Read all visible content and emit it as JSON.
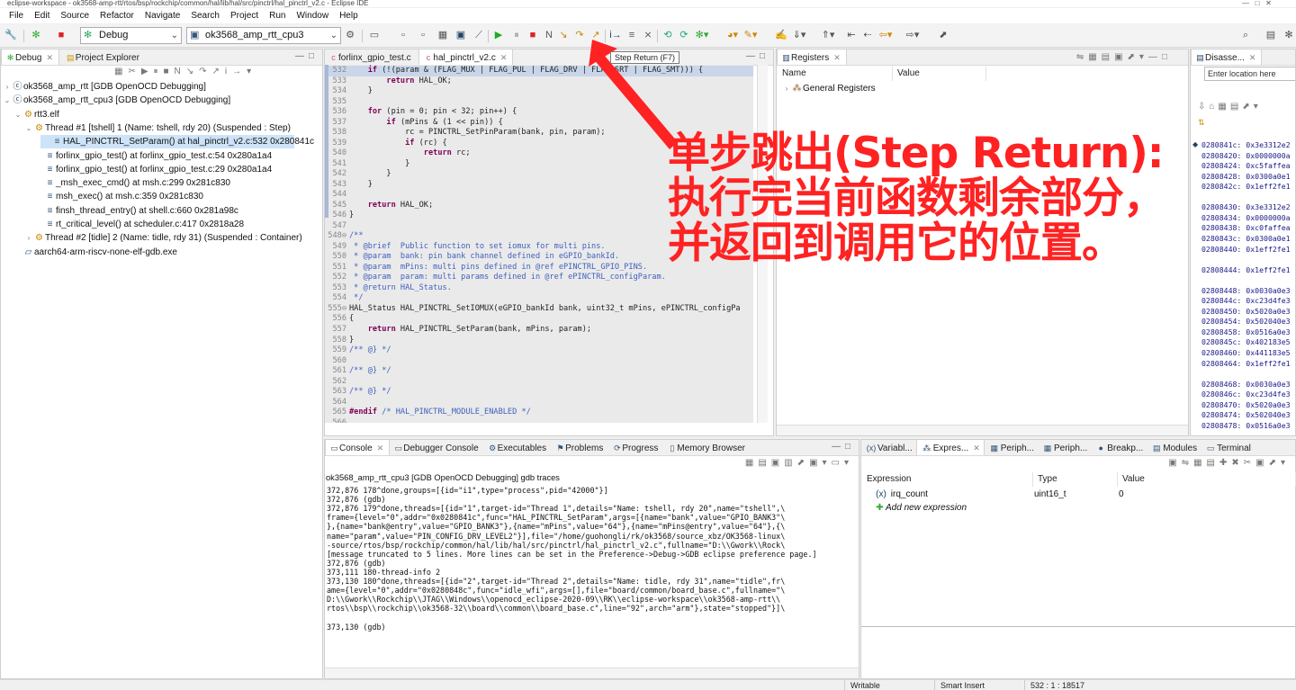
{
  "window": {
    "title": "eclipse-workspace - ok3568-amp-rtt/rtos/bsp/rockchip/common/hal/lib/hal/src/pinctrl/hal_pinctrl_v2.c - Eclipse IDE"
  },
  "menu": [
    "File",
    "Edit",
    "Source",
    "Refactor",
    "Navigate",
    "Search",
    "Project",
    "Run",
    "Window",
    "Help"
  ],
  "toolbar": {
    "mode_combo": "Debug",
    "config_combo": "ok3568_amp_rtt_cpu3",
    "tooltip": "Step Return (F7)"
  },
  "debug_panel": {
    "tabs": [
      "Debug",
      "Project Explorer"
    ],
    "tree": [
      {
        "text": "ok3568_amp_rtt [GDB OpenOCD Debugging]",
        "level": 0,
        "twisty": "›",
        "icon": "c-launch-icon"
      },
      {
        "text": "ok3568_amp_rtt_cpu3 [GDB OpenOCD Debugging]",
        "level": 0,
        "twisty": "⌄",
        "icon": "c-launch-icon"
      },
      {
        "text": "rtt3.elf",
        "level": 1,
        "twisty": "⌄",
        "icon": "process-icon"
      },
      {
        "text": "Thread #1 [tshell] 1 (Name: tshell, rdy 20) (Suspended : Step)",
        "level": 2,
        "twisty": "⌄",
        "icon": "thread-icon"
      },
      {
        "text": "HAL_PINCTRL_SetParam() at hal_pinctrl_v2.c:532 0x280841c",
        "level": 3,
        "twisty": "",
        "icon": "stack-frame-icon",
        "selected": true
      },
      {
        "text": "forlinx_gpio_test() at forlinx_gpio_test.c:54 0x280a1a4",
        "level": 3,
        "twisty": "",
        "icon": "stack-frame-icon"
      },
      {
        "text": "forlinx_gpio_test() at forlinx_gpio_test.c:29 0x280a1a4",
        "level": 3,
        "twisty": "",
        "icon": "stack-frame-icon"
      },
      {
        "text": "_msh_exec_cmd() at msh.c:299 0x281c830",
        "level": 3,
        "twisty": "",
        "icon": "stack-frame-icon"
      },
      {
        "text": "msh_exec() at msh.c:359 0x281c830",
        "level": 3,
        "twisty": "",
        "icon": "stack-frame-icon"
      },
      {
        "text": "finsh_thread_entry() at shell.c:660 0x281a98c",
        "level": 3,
        "twisty": "",
        "icon": "stack-frame-icon"
      },
      {
        "text": "rt_critical_level() at scheduler.c:417 0x2818a28",
        "level": 3,
        "twisty": "",
        "icon": "stack-frame-icon"
      },
      {
        "text": "Thread #2 [tidle] 2 (Name: tidle, rdy 31) (Suspended : Container)",
        "level": 2,
        "twisty": "›",
        "icon": "thread-icon"
      },
      {
        "text": "aarch64-arm-riscv-none-elf-gdb.exe",
        "level": 1,
        "twisty": "",
        "icon": "gdb-icon"
      }
    ]
  },
  "editor": {
    "tabs": [
      "forlinx_gpio_test.c",
      "hal_pinctrl_v2.c"
    ],
    "lines": [
      {
        "n": "532",
        "t": "    if (!(param & (FLAG_MUX | FLAG_PUL | FLAG_DRV | FLAG_SRT | FLAG_SMT))) {"
      },
      {
        "n": "533",
        "t": "        return HAL_OK;"
      },
      {
        "n": "534",
        "t": "    }"
      },
      {
        "n": "535",
        "t": ""
      },
      {
        "n": "536",
        "t": "    for (pin = 0; pin < 32; pin++) {"
      },
      {
        "n": "537",
        "t": "        if (mPins & (1 << pin)) {"
      },
      {
        "n": "538",
        "t": "            rc = PINCTRL_SetPinParam(bank, pin, param);"
      },
      {
        "n": "539",
        "t": "            if (rc) {"
      },
      {
        "n": "540",
        "t": "                return rc;"
      },
      {
        "n": "541",
        "t": "            }"
      },
      {
        "n": "542",
        "t": "        }"
      },
      {
        "n": "543",
        "t": "    }"
      },
      {
        "n": "544",
        "t": ""
      },
      {
        "n": "545",
        "t": "    return HAL_OK;"
      },
      {
        "n": "546",
        "t": "}"
      },
      {
        "n": "547",
        "t": ""
      },
      {
        "n": "548⊖",
        "t": "/**"
      },
      {
        "n": "549",
        "t": " * @brief  Public function to set iomux for multi pins."
      },
      {
        "n": "550",
        "t": " * @param  bank: pin bank channel defined in eGPIO_bankId."
      },
      {
        "n": "551",
        "t": " * @param  mPins: multi pins defined in @ref ePINCTRL_GPIO_PINS."
      },
      {
        "n": "552",
        "t": " * @param  param: multi params defined in @ref ePINCTRL_configParam."
      },
      {
        "n": "553",
        "t": " * @return HAL_Status."
      },
      {
        "n": "554",
        "t": " */"
      },
      {
        "n": "555⊖",
        "t": "HAL_Status HAL_PINCTRL_SetIOMUX(eGPIO_bankId bank, uint32_t mPins, ePINCTRL_configPa"
      },
      {
        "n": "556",
        "t": "{"
      },
      {
        "n": "557",
        "t": "    return HAL_PINCTRL_SetParam(bank, mPins, param);"
      },
      {
        "n": "558",
        "t": "}"
      },
      {
        "n": "559",
        "t": "/** @} */"
      },
      {
        "n": "560",
        "t": ""
      },
      {
        "n": "561",
        "t": "/** @} */"
      },
      {
        "n": "562",
        "t": ""
      },
      {
        "n": "563",
        "t": "/** @} */"
      },
      {
        "n": "564",
        "t": ""
      },
      {
        "n": "565",
        "t": "#endif /* HAL_PINCTRL_MODULE_ENABLED */"
      },
      {
        "n": "566",
        "t": ""
      }
    ]
  },
  "registers": {
    "tab": "Registers",
    "col_name": "Name",
    "col_value": "Value",
    "rows": [
      "General Registers"
    ]
  },
  "disasm": {
    "tab": "Disasse...",
    "location_placeholder": "Enter location here",
    "lines": [
      "0280841c: 0x3e3312e2",
      "02808420: 0x0000000a",
      "02808424: 0xc5faffea",
      "02808428: 0x0300a0e1",
      "0280842c: 0x1eff2fe1",
      "",
      "02808430: 0x3e3312e2",
      "02808434: 0x0000000a",
      "02808438: 0xc0faffea",
      "0280843c: 0x0300a0e1",
      "02808440: 0x1eff2fe1",
      "",
      "02808444: 0x1eff2fe1",
      "",
      "02808448: 0x0030a0e3",
      "0280844c: 0xc23d4fe3",
      "02808450: 0x5020a0e3",
      "02808454: 0x502040e3",
      "02808458: 0x0516a0e3",
      "0280845c: 0x402183e5",
      "02808460: 0x441183e5",
      "02808464: 0x1eff2fe1",
      "",
      "02808468: 0x0030a0e3",
      "0280846c: 0xc23d4fe3",
      "02808470: 0x5020a0e3",
      "02808474: 0x502040e3",
      "02808478: 0x0516a0e3"
    ]
  },
  "console": {
    "tabs": [
      "Console",
      "Debugger Console",
      "Executables",
      "Problems",
      "Progress",
      "Memory Browser"
    ],
    "header": "ok3568_amp_rtt_cpu3 [GDB OpenOCD Debugging] gdb traces",
    "lines": [
      "372,876 178^done,groups=[{id=\"i1\",type=\"process\",pid=\"42000\"}]",
      "372,876 (gdb)",
      "372,876 179^done,threads=[{id=\"1\",target-id=\"Thread 1\",details=\"Name: tshell, rdy 20\",name=\"tshell\",\\",
      "frame={level=\"0\",addr=\"0x0280841c\",func=\"HAL_PINCTRL_SetParam\",args=[{name=\"bank\",value=\"GPIO_BANK3\"\\",
      "},{name=\"bank@entry\",value=\"GPIO_BANK3\"},{name=\"mPins\",value=\"64\"},{name=\"mPins@entry\",value=\"64\"},{\\",
      "name=\"param\",value=\"PIN_CONFIG_DRV_LEVEL2\"}],file=\"/home/guohongli/rk/ok3568/source_xbz/OK3568-linux\\",
      "-source/rtos/bsp/rockchip/common/hal/lib/hal/src/pinctrl/hal_pinctrl_v2.c\",fullname=\"D:\\\\Gwork\\\\Rock\\",
      "[message truncated to 5 lines. More lines can be set in the Preference->Debug->GDB eclipse preference page.]",
      "372,876 (gdb)",
      "373,111 180-thread-info 2",
      "373,130 180^done,threads=[{id=\"2\",target-id=\"Thread 2\",details=\"Name: tidle, rdy 31\",name=\"tidle\",fr\\",
      "ame={level=\"0\",addr=\"0x0280848c\",func=\"idle_wfi\",args=[],file=\"board/common/board_base.c\",fullname=\"\\",
      "D:\\\\Gwork\\\\Rockchip\\\\JTAG\\\\Windows\\\\openocd_eclipse-2020-09\\\\RK\\\\eclipse-workspace\\\\ok3568-amp-rtt\\\\",
      "rtos\\\\bsp\\\\rockchip\\\\ok3568-32\\\\board\\\\common\\\\board_base.c\",line=\"92\",arch=\"arm\"},state=\"stopped\"}]\\",
      "",
      "373,130 (gdb)"
    ]
  },
  "expressions": {
    "tabs": [
      "Variabl...",
      "Expres...",
      "Periph...",
      "Periph...",
      "Breakp...",
      "Modules",
      "Terminal"
    ],
    "col_expression": "Expression",
    "col_type": "Type",
    "col_value": "Value",
    "rows": [
      {
        "name": "irq_count",
        "type": "uint16_t",
        "value": "0"
      }
    ],
    "add_label": "Add new expression"
  },
  "statusbar": {
    "writable": "Writable",
    "insert_mode": "Smart Insert",
    "position": "532 : 1 : 18517"
  },
  "annotation": {
    "text": "单步跳出(Step Return):\n执行完当前函数剩余部分，\n并返回到调用它的位置。",
    "color": "#ff2222"
  }
}
